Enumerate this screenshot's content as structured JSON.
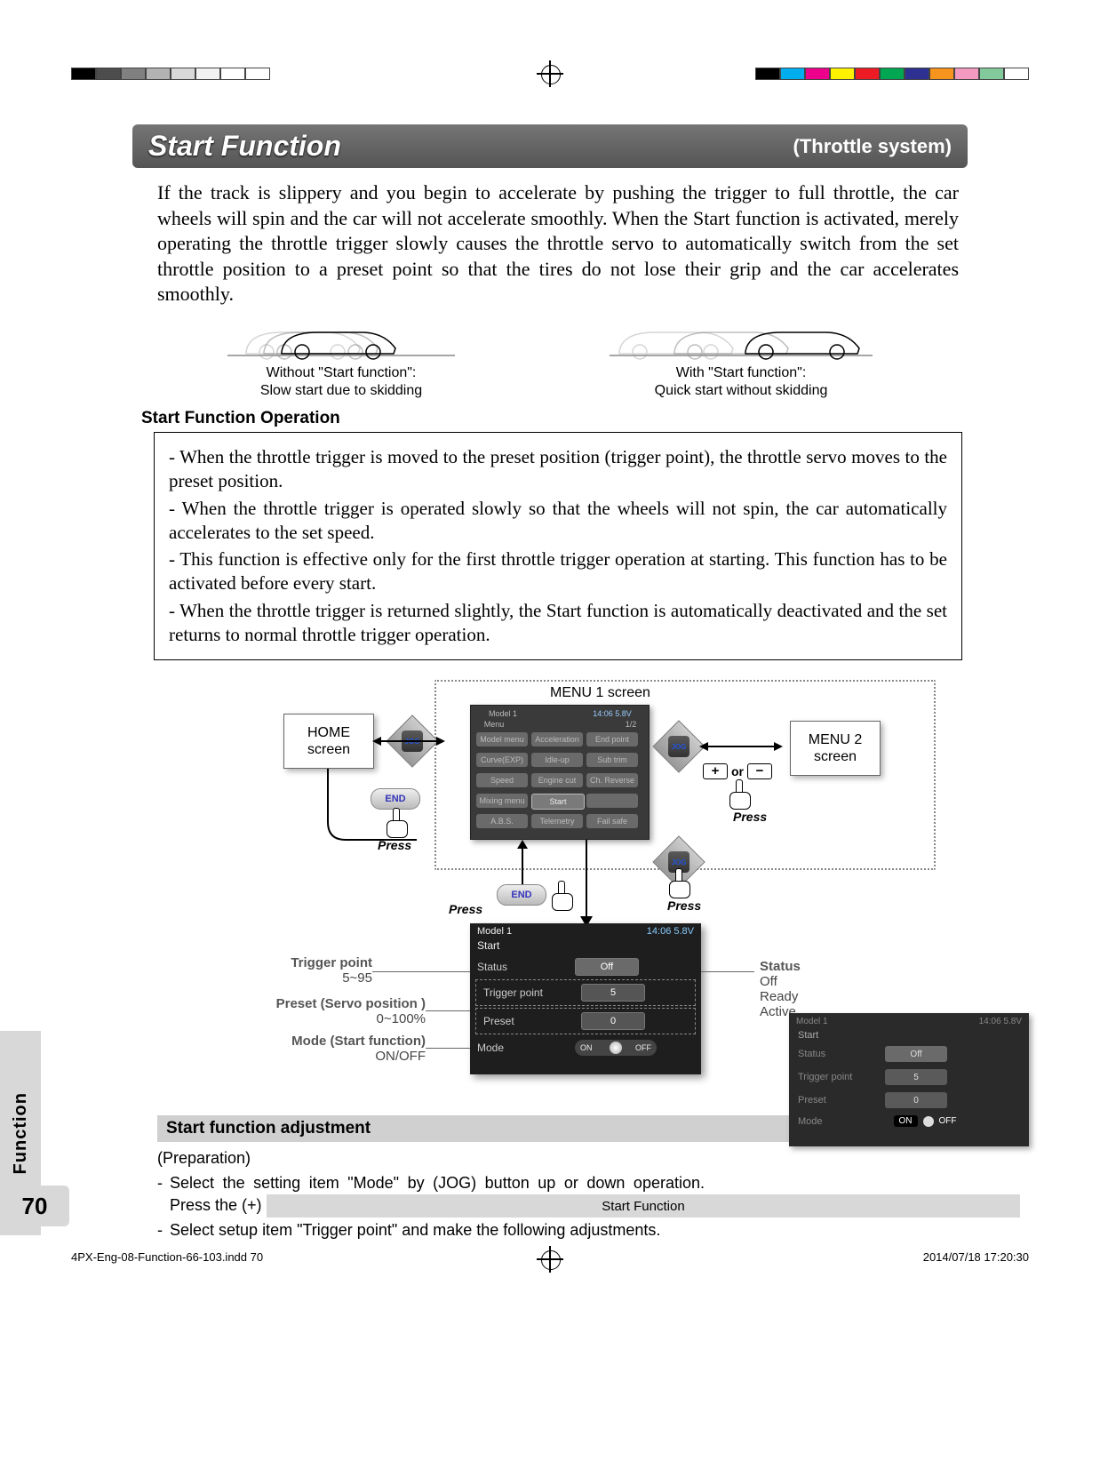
{
  "print": {
    "left_swatches": [
      "#000",
      "#4d4d4d",
      "#808080",
      "#b3b3b3",
      "#d9d9d9",
      "#f2f2f2",
      "#ffffff",
      "#ffffff"
    ],
    "right_swatches": [
      "#000",
      "#00aeef",
      "#ec008c",
      "#fff200",
      "#ed1c24",
      "#00a651",
      "#2e3192",
      "#f7941d",
      "#f49ac1",
      "#82ca9c",
      "#ffffff"
    ],
    "footer_file": "4PX-Eng-08-Function-66-103.indd   70",
    "footer_date": "2014/07/18   17:20:30"
  },
  "header": {
    "title": "Start Function",
    "subtitle": "(Throttle system)"
  },
  "intro": "If the track is slippery and you begin to accelerate by pushing the trigger to full throttle, the car wheels will spin and the car will not accelerate smoothly. When the Start function is activated, merely operating the throttle trigger slowly causes the throttle servo to automatically switch from the set throttle position to a preset point so that the tires do not lose their grip and the car accelerates smoothly.",
  "car_captions": {
    "left_l1": "Without \"Start function\":",
    "left_l2": "Slow start due to skidding",
    "right_l1": "With \"Start function\":",
    "right_l2": "Quick start without skidding"
  },
  "operation": {
    "heading": "Start Function Operation",
    "b1": "- When the throttle trigger is moved to the preset position (trigger point), the throttle servo moves to the preset position.",
    "b2": "- When the throttle trigger is operated slowly so that the wheels will not spin, the car automatically accelerates to the set speed.",
    "b3": "- This function is effective only for the first throttle trigger operation at starting. This function has to be activated before every start.",
    "b4": "- When the throttle trigger is returned slightly, the Start function is automatically deactivated and the set returns to normal throttle trigger operation."
  },
  "diagram": {
    "home": "HOME\nscreen",
    "menu1": "MENU 1 screen",
    "menu2": "MENU 2\nscreen",
    "jog": "JOG",
    "end": "END",
    "press": "Press",
    "or": "or",
    "menu1_items": [
      "Model menu",
      "Acceleration",
      "End point",
      "Curve(EXP)",
      "Idle-up",
      "Sub trim",
      "Speed",
      "Engine cut",
      "Ch. Reverse",
      "Mixing menu",
      "Start",
      "",
      "A.B.S.",
      "Telemetry",
      "Fail safe"
    ],
    "menu1_top_left": "Model 1",
    "menu1_top_right": "14:06  5.8V",
    "menu1_sub": "Menu",
    "menu1_page": "1/2"
  },
  "settings": {
    "top_left": "Model 1",
    "top_right": "14:06  5.8V",
    "title": "Start",
    "rows": {
      "status_lbl": "Status",
      "status_val": "Off",
      "trigger_lbl": "Trigger point",
      "trigger_val": "5",
      "preset_lbl": "Preset",
      "preset_val": "0",
      "mode_lbl": "Mode",
      "mode_on": "ON",
      "mode_off": "OFF"
    }
  },
  "leaders": {
    "trigger_t": "Trigger point",
    "trigger_s": "5~95",
    "preset_t": "Preset (Servo position )",
    "preset_s": "0~100%",
    "mode_t": "Mode (Start function)",
    "mode_s": "ON/OFF",
    "status_t": "Status",
    "status_s1": "Off",
    "status_s2": "Ready",
    "status_s3": "Active"
  },
  "adjust": {
    "heading": "Start function adjustment",
    "prep": "(Preparation)",
    "b1": "Select the setting item \"Mode\" by (JOG) button up or down operation. Press the (+) or (-) button and select \"ON\".",
    "b2": "Select setup item \"Trigger point\" and make the following adjustments."
  },
  "thumb": {
    "top_left": "Model 1",
    "top_right": "14:06  5.8V",
    "title": "Start",
    "status_lbl": "Status",
    "status_val": "Off",
    "trigger_lbl": "Trigger point",
    "trigger_val": "5",
    "preset_lbl": "Preset",
    "preset_val": "0",
    "mode_lbl": "Mode",
    "mode_on": "ON",
    "mode_off": "OFF"
  },
  "footer": {
    "section_tab": "Function",
    "page_num": "70",
    "footer_title": "Start Function"
  }
}
